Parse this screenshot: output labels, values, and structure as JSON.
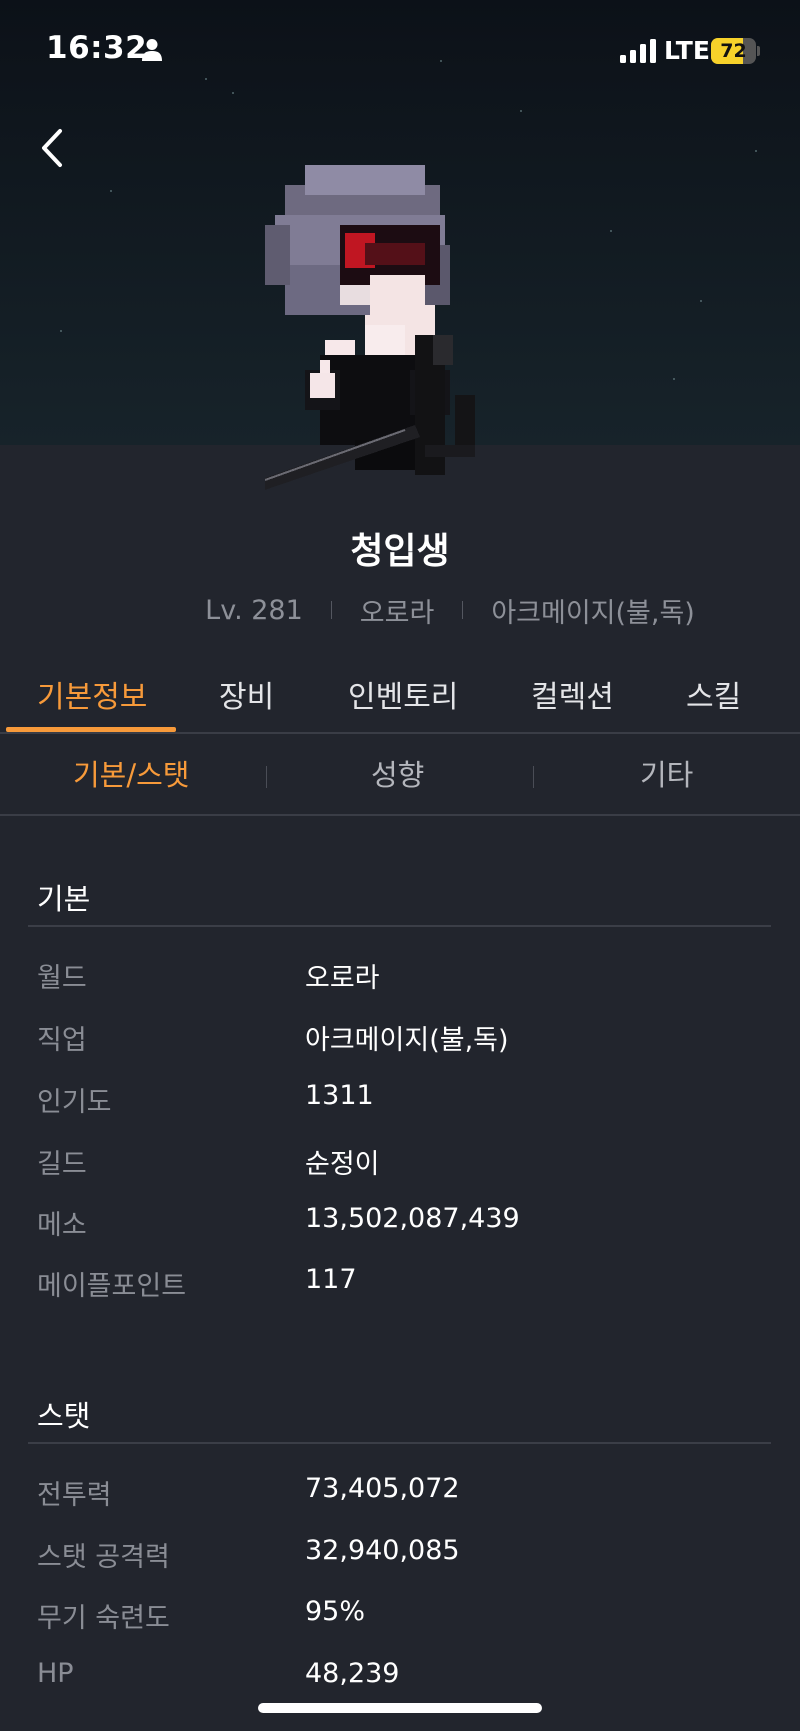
{
  "status_bar": {
    "time": "16:32",
    "network": "LTE",
    "battery": "72",
    "battery_level_percent": 72,
    "icons": [
      "person-icon",
      "cellular-signal-icon",
      "battery-icon"
    ]
  },
  "header": {
    "back_icon": "chevron-left-icon",
    "character_name": "청입생",
    "level": "Lv. 281",
    "world": "오로라",
    "job": "아크메이지(불,독)"
  },
  "tabs": [
    {
      "label": "기본정보",
      "active": true
    },
    {
      "label": "장비",
      "active": false
    },
    {
      "label": "인벤토리",
      "active": false
    },
    {
      "label": "컬렉션",
      "active": false
    },
    {
      "label": "스킬",
      "active": false
    }
  ],
  "subtabs": [
    {
      "label": "기본/스탯",
      "active": true
    },
    {
      "label": "성향",
      "active": false
    },
    {
      "label": "기타",
      "active": false
    }
  ],
  "basic": {
    "title": "기본",
    "rows": [
      {
        "label": "월드",
        "value": "오로라"
      },
      {
        "label": "직업",
        "value": "아크메이지(불,독)"
      },
      {
        "label": "인기도",
        "value": "1311"
      },
      {
        "label": "길드",
        "value": "순정이"
      },
      {
        "label": "메소",
        "value": "13,502,087,439"
      },
      {
        "label": "메이플포인트",
        "value": "117"
      }
    ]
  },
  "stats": {
    "title": "스탯",
    "rows": [
      {
        "label": "전투력",
        "value": "73,405,072"
      },
      {
        "label": "스탯 공격력",
        "value": "32,940,085"
      },
      {
        "label": "무기 숙련도",
        "value": "95%"
      },
      {
        "label": "HP",
        "value": "48,239"
      }
    ]
  },
  "colors": {
    "accent": "#f79a3a",
    "background": "#22252d",
    "hero_background": "#0f171e",
    "label_text": "#8a8d95",
    "battery": "#f7d22a"
  }
}
